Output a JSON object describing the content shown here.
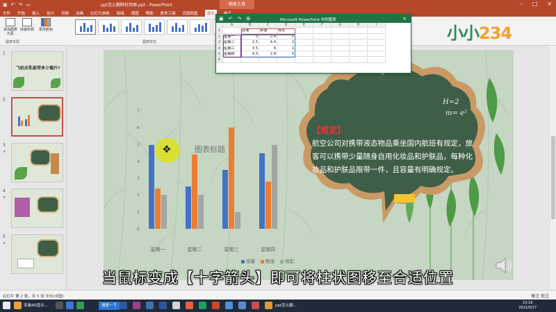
{
  "app": {
    "qat_icons": [
      "save-icon",
      "undo-icon",
      "redo-icon",
      "present-icon"
    ],
    "doc_title": "ppt怎么删除柱状图.ppt - PowerPoint",
    "context_tab": "图表工具",
    "window_buttons": [
      "–",
      "□",
      "×"
    ]
  },
  "tabs": [
    "文件",
    "开始",
    "插入",
    "设计",
    "切换",
    "动画",
    "幻灯片放映",
    "审阅",
    "视图",
    "帮助",
    "更多工具",
    "百度网盘",
    "设计",
    "格式"
  ],
  "ribbon": {
    "add_element": "添加图表元素",
    "quick_layout": "快速布局",
    "change_colors": "更改颜色",
    "group_layout": "图表布局",
    "group_styles": "图表样式"
  },
  "logo": {
    "part1": "小小",
    "part2": "234"
  },
  "slides_panel": [
    {
      "num": "1",
      "title": "飞机水乳能带多少毫升?"
    },
    {
      "num": "2"
    },
    {
      "num": "3"
    },
    {
      "num": "4"
    },
    {
      "num": "5"
    }
  ],
  "excel": {
    "title": "Microsoft PowerPoint 中的图表",
    "col_headers": [
      "",
      "A",
      "B",
      "C",
      "D",
      "E",
      "F",
      "G",
      "H",
      "I"
    ],
    "row_headers": [
      "1",
      "2",
      "3",
      "4",
      "5",
      "6"
    ],
    "rows": [
      [
        "",
        "容量",
        "数值",
        "规定"
      ],
      [
        "星期一",
        "5",
        "2.4",
        "2"
      ],
      [
        "星期二",
        "2.5",
        "4.4",
        "2"
      ],
      [
        "星期三",
        "3.5",
        "6",
        "1"
      ],
      [
        "星期四",
        "4.5",
        "2.8",
        "5"
      ]
    ]
  },
  "chart_data": {
    "type": "bar",
    "title": "图表标题",
    "categories": [
      "星期一",
      "星期二",
      "星期三",
      "星期四"
    ],
    "series": [
      {
        "name": "容量",
        "values": [
          5,
          2.5,
          3.5,
          4.5
        ],
        "color": "#4472c4"
      },
      {
        "name": "数值",
        "values": [
          2.4,
          4.4,
          6,
          2.8
        ],
        "color": "#ed7d31"
      },
      {
        "name": "规定",
        "values": [
          2,
          2,
          1,
          5
        ],
        "color": "#a5a5a5"
      }
    ],
    "yticks": [
      0,
      1,
      2,
      3,
      4,
      5,
      6,
      7
    ],
    "ylim": [
      0,
      7
    ],
    "legend": "bottom"
  },
  "board": {
    "heading": "【规定】",
    "body": "航空公司对携带液态物品乘坐国内航班有规定，旅客可以携带少量随身自用化妆品和护肤品，每种化妆品和护肤品限带一件，且容量有明确规定。",
    "chalk1": "H=2",
    "chalk2": "m= e²"
  },
  "subtitle": "当鼠标变成【十字箭头】即可将柱状图移至合适位置",
  "status": {
    "left": "幻灯片 第 2 张，共 5 张    中文(中国)",
    "right": "备注  批注"
  },
  "taskbar": {
    "search": "搜索一下",
    "clock_time": "10:18",
    "clock_date": "2021/9/17",
    "app_label1": "安装4D显示...",
    "app_label2": "ppt怎么删..."
  }
}
